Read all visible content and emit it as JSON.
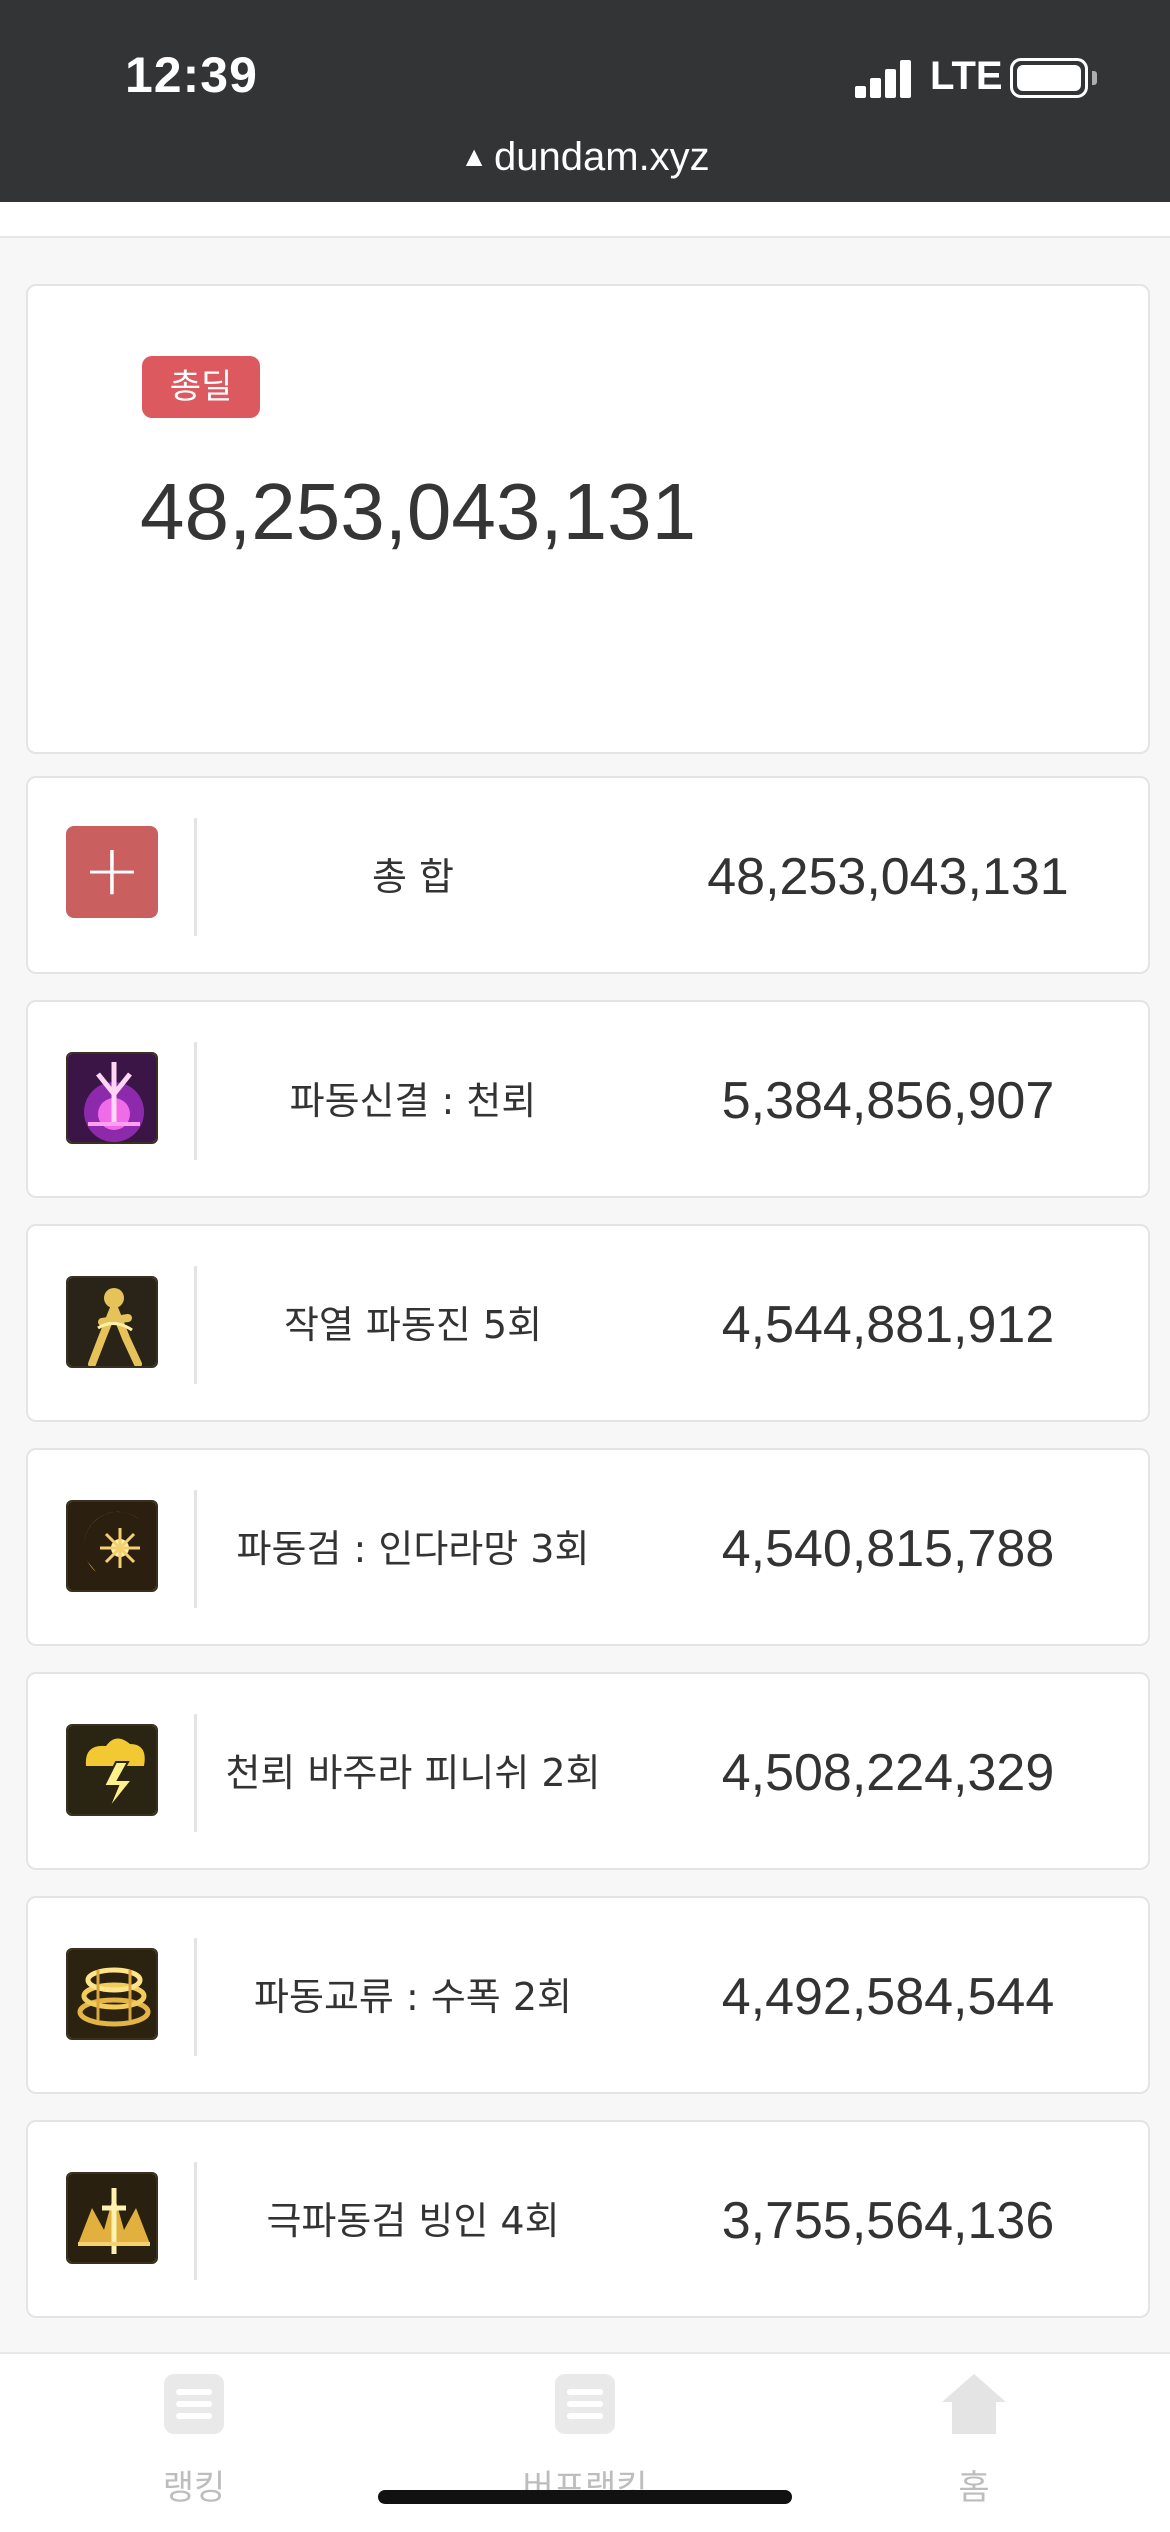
{
  "status_bar": {
    "time": "12:39",
    "network": "LTE",
    "url": "dundam.xyz"
  },
  "summary": {
    "badge": "총딜",
    "total": "48,253,043,131"
  },
  "total_row": {
    "icon": "plus-icon",
    "name": "총 합",
    "value": "48,253,043,131"
  },
  "skills": [
    {
      "name": "파동신결 : 천뢰",
      "value": "5,384,856,907",
      "icon": "lightning-sword-icon"
    },
    {
      "name": "작열 파동진 5회",
      "value": "4,544,881,912",
      "icon": "burning-figure-icon"
    },
    {
      "name": "파동검 : 인다라망 3회",
      "value": "4,540,815,788",
      "icon": "crescent-burst-icon"
    },
    {
      "name": "천뢰 바주라 피니쉬 2회",
      "value": "4,508,224,329",
      "icon": "thunder-cloud-icon"
    },
    {
      "name": "파동교류 : 수폭 2회",
      "value": "4,492,584,544",
      "icon": "vortex-ring-icon"
    },
    {
      "name": "극파동검 빙인 4회",
      "value": "3,755,564,136",
      "icon": "ice-blade-icon"
    }
  ],
  "bottom_nav": [
    {
      "label": "랭킹",
      "icon": "list-icon"
    },
    {
      "label": "버프랭킹",
      "icon": "list-icon"
    },
    {
      "label": "홈",
      "icon": "home-icon"
    }
  ],
  "colors": {
    "badge": "#dc5a5f",
    "plus_button": "#c95f5f",
    "status_bar": "#333436"
  }
}
